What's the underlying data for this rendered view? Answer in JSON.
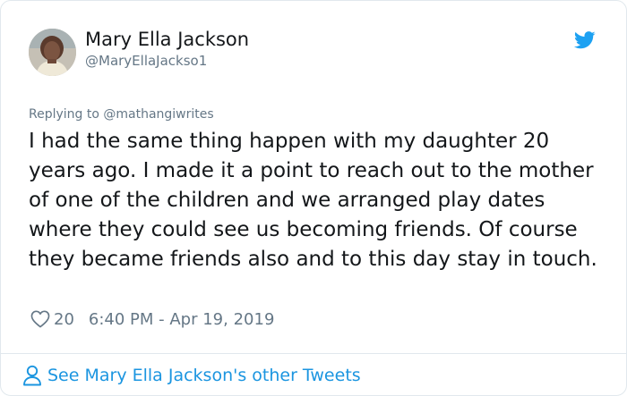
{
  "user": {
    "display_name": "Mary Ella Jackson",
    "handle": "@MaryEllaJackso1"
  },
  "reply": {
    "text": "Replying to @mathangiwrites"
  },
  "tweet": {
    "text": "I had the same thing happen with my daughter 20 years ago. I made it a point to reach out to the mother of one of the children and we arranged play dates where they could see us becoming friends. Of course they became friends also and to this day stay in touch.",
    "like_count": "20",
    "timestamp": "6:40 PM - Apr 19, 2019"
  },
  "footer": {
    "link_text": "See Mary Ella Jackson's other Tweets"
  },
  "icons": {
    "brand": "twitter-bird-icon",
    "like": "heart-icon",
    "profile": "person-icon"
  },
  "colors": {
    "twitter_blue": "#1da1f2",
    "link_blue": "#1b95e0",
    "text": "#14171a",
    "muted": "#657786",
    "border": "#e1e8ed"
  }
}
